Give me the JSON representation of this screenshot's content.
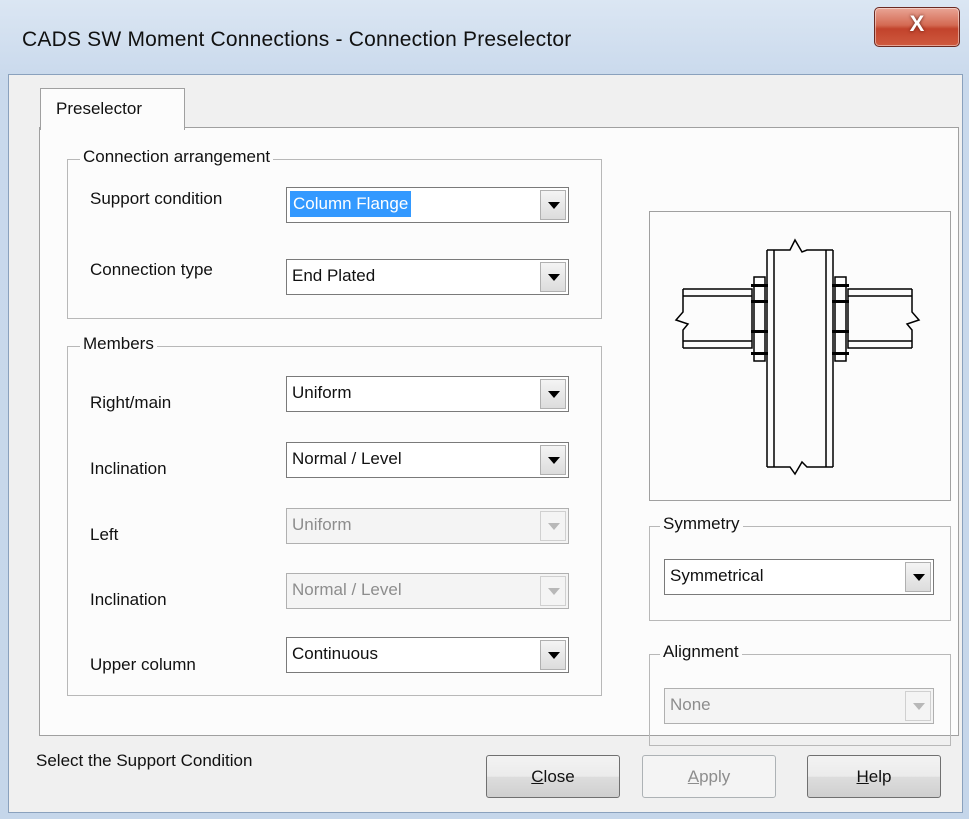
{
  "window": {
    "title": "CADS SW Moment Connections - Connection Preselector",
    "close_glyph": "X"
  },
  "tabs": [
    {
      "label": "Preselector"
    }
  ],
  "connection_arrangement": {
    "legend": "Connection arrangement",
    "support_condition": {
      "label": "Support condition",
      "value": "Column Flange"
    },
    "connection_type": {
      "label": "Connection type",
      "value": "End Plated"
    }
  },
  "members": {
    "legend": "Members",
    "right_main": {
      "label": "Right/main",
      "value": "Uniform"
    },
    "inclination_right": {
      "label": "Inclination",
      "value": "Normal / Level"
    },
    "left": {
      "label": "Left",
      "value": "Uniform"
    },
    "inclination_left": {
      "label": "Inclination",
      "value": "Normal / Level"
    },
    "upper_column": {
      "label": "Upper column",
      "value": "Continuous"
    }
  },
  "symmetry": {
    "legend": "Symmetry",
    "value": "Symmetrical"
  },
  "alignment": {
    "legend": "Alignment",
    "value": "None"
  },
  "status": {
    "text": "Select the Support Condition"
  },
  "buttons": {
    "close": {
      "pre": "",
      "key": "C",
      "post": "lose"
    },
    "apply": {
      "pre": "",
      "key": "A",
      "post": "pply"
    },
    "help": {
      "pre": "",
      "key": "H",
      "post": "elp"
    }
  },
  "icons": {
    "dropdown": "chevron-down-icon",
    "close": "close-icon"
  }
}
